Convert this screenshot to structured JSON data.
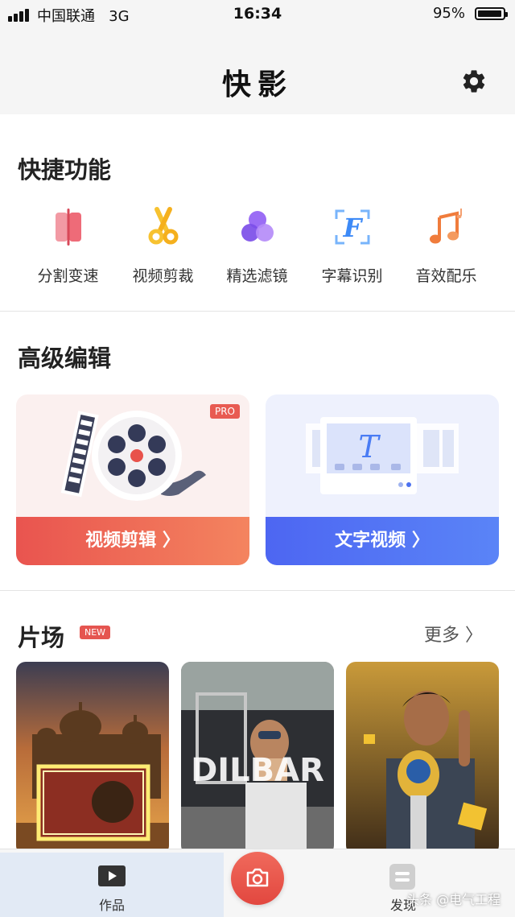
{
  "status_bar": {
    "carrier": "中国联通",
    "network": "3G",
    "time": "16:34",
    "battery": "95%",
    "battery_level": 0.95
  },
  "header": {
    "title": "快影",
    "settings_icon": "gear-icon"
  },
  "quick_functions": {
    "title": "快捷功能",
    "items": [
      {
        "label": "分割变速",
        "icon": "split-speed-icon",
        "color": "#ee6b78"
      },
      {
        "label": "视频剪裁",
        "icon": "scissors-icon",
        "color": "#f7c230"
      },
      {
        "label": "精选滤镜",
        "icon": "filter-circles-icon",
        "color": "#8a5cf0"
      },
      {
        "label": "字幕识别",
        "icon": "subtitle-recognition-icon",
        "color": "#3d8af7"
      },
      {
        "label": "音效配乐",
        "icon": "music-note-icon",
        "color": "#f07c3c"
      }
    ]
  },
  "advanced_edit": {
    "title": "高级编辑",
    "cards": [
      {
        "label": "视频剪辑 〉",
        "badge": "PRO",
        "art": "film-reel-icon"
      },
      {
        "label": "文字视频 〉",
        "art": "text-video-icon",
        "art_letter": "T"
      }
    ]
  },
  "scenes": {
    "title": "片场",
    "badge": "NEW",
    "more": "更多 〉",
    "thumbnails": [
      {
        "name": "golden-temple-frame"
      },
      {
        "name": "dilbar-poster",
        "text": "DILBAR"
      },
      {
        "name": "trophy-man"
      }
    ]
  },
  "tab_bar": {
    "works_label": "作品",
    "discover_label": "发现",
    "camera_icon": "camera-icon"
  },
  "watermark": "头条 @电气工程",
  "colors": {
    "accent_red": "#e9544f",
    "accent_blue": "#4d66f2",
    "background": "#f5f5f5"
  }
}
